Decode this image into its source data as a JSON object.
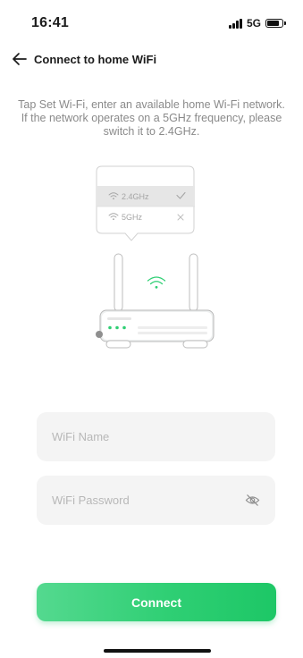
{
  "status_bar": {
    "time": "16:41",
    "network": "5G",
    "battery_level": 0.85
  },
  "header": {
    "back_icon": "arrow-left-icon",
    "title": "Connect to home WiFi"
  },
  "instructions": "Tap Set Wi-Fi, enter an available home Wi-Fi network. If the network operates on a 5GHz frequency, please switch it to 2.4GHz.",
  "illustration": {
    "bands": [
      {
        "label": "2.4GHz",
        "status_icon": "check-icon"
      },
      {
        "label": "5GHz",
        "status_icon": "cross-icon"
      }
    ],
    "accent": "#2fcf74"
  },
  "form": {
    "wifi_name_placeholder": "WiFi Name",
    "wifi_password_placeholder": "WiFi Password",
    "password_toggle_icon": "eye-off-icon"
  },
  "connect_label": "Connect",
  "colors": {
    "accent": "#2fcf74",
    "field_background": "#f4f4f4",
    "instruction_text": "#8a8a8a"
  }
}
